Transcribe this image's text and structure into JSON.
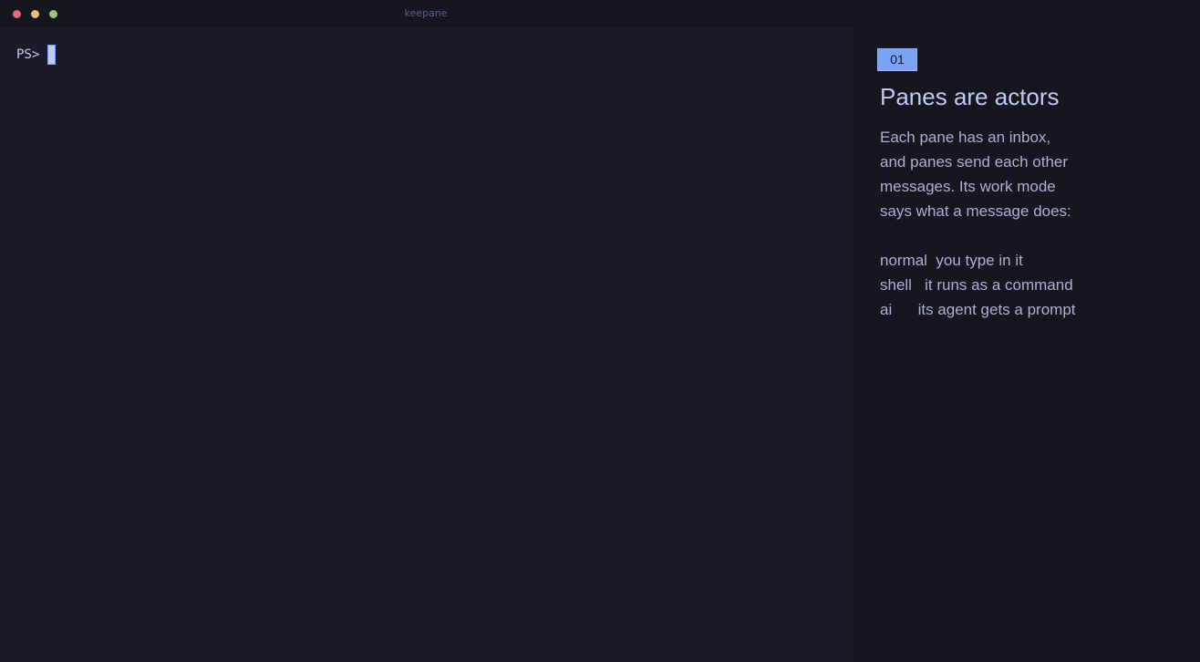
{
  "window": {
    "title": "keepane"
  },
  "terminal": {
    "prompt": "PS>"
  },
  "sidebar": {
    "badge": "01",
    "heading": "Panes are actors",
    "paragraph_lines": [
      "Each pane has an inbox,",
      "and panes send each other",
      "messages. Its work mode",
      "says what a message does:"
    ],
    "modes": [
      "normal  you type in it",
      "shell   it runs as a command",
      "ai      its agent gets a prompt"
    ]
  },
  "colors": {
    "background": "#1a1b26",
    "sidebar_background": "#16161e",
    "accent": "#7aa2f7",
    "text": "#a9b1d6",
    "heading": "#c0caf5",
    "close": "#e06c75",
    "minimize": "#e5c07b",
    "maximize": "#98c379"
  }
}
